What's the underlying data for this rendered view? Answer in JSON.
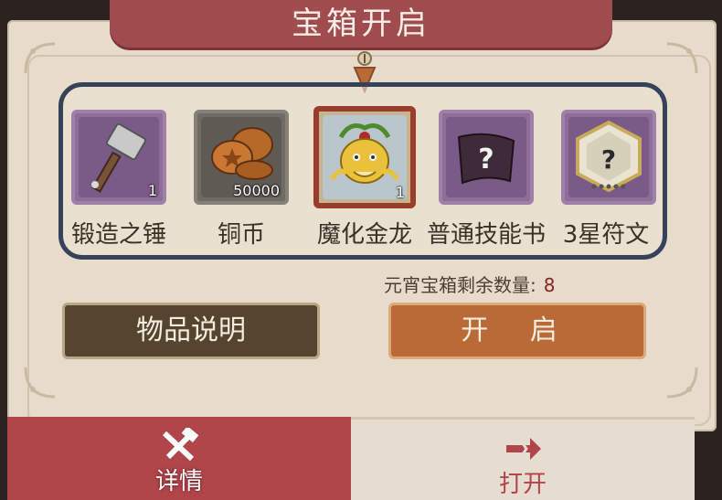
{
  "dialog": {
    "title": "宝箱开启"
  },
  "items": [
    {
      "label": "锻造之锤",
      "count": "1",
      "icon": "hammer-icon",
      "frame": "purple"
    },
    {
      "label": "铜币",
      "count": "50000",
      "icon": "copper-coins-icon",
      "frame": "gray"
    },
    {
      "label": "魔化金龙",
      "count": "1",
      "icon": "golden-dragon-icon",
      "frame": "selected"
    },
    {
      "label": "普通技能书",
      "count": "",
      "icon": "skill-scroll-icon",
      "frame": "purple"
    },
    {
      "label": "3星符文",
      "count": "",
      "icon": "rune-icon",
      "frame": "purple"
    }
  ],
  "remaining": {
    "label": "元宵宝箱剩余数量:",
    "value": "8"
  },
  "buttons": {
    "item_info": "物品说明",
    "open": "开 启"
  },
  "tabs": {
    "details": "详情",
    "open": "打开"
  },
  "colors": {
    "banner": "#a04b4e",
    "panel": "#e7dccb",
    "frame": "#36425a",
    "button_dark": "#55452f",
    "button_orange": "#b96a36",
    "tab_active": "#b0454a"
  }
}
